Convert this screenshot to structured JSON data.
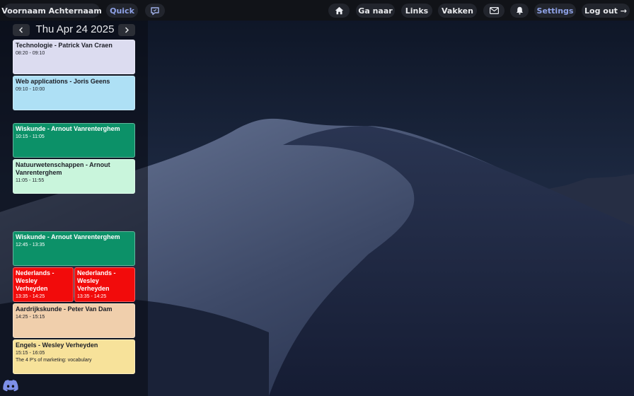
{
  "topbar": {
    "user_name": "Voornaam Achternaam",
    "quick_label": "Quick",
    "ga_naar_label": "Ga naar",
    "links_label": "Links",
    "vakken_label": "Vakken",
    "settings_label": "Settings",
    "logout_label": "Log out →",
    "icons": [
      "home-icon",
      "chat-icon",
      "mail-icon",
      "bell-icon"
    ]
  },
  "calendar": {
    "date": "Thu Apr 24 2025",
    "events": [
      {
        "title": "Technologie - Patrick Van Craen",
        "time": "08:20 - 09:10",
        "note": "",
        "color": "#dcdcf0"
      },
      {
        "title": "Web applications - Joris Geens",
        "time": "09:10 - 10:00",
        "note": "",
        "color": "#aee0f5"
      },
      {
        "title": "Wiskunde - Arnout Vanrenterghem",
        "time": "10:15 - 11:05",
        "note": "",
        "color": "#0c9168"
      },
      {
        "title": "Natuurwetenschappen - Arnout Vanrenterghem",
        "time": "11:05 - 11:55",
        "note": "",
        "color": "#c9f5dc"
      },
      {
        "title": "Wiskunde - Arnout Vanrenterghem",
        "time": "12:45 - 13:35",
        "note": "",
        "color": "#0c9168"
      },
      {
        "title": "Nederlands - Wesley Verheyden",
        "time": "13:35 - 14:25",
        "note": "",
        "color": "#f20b0b"
      },
      {
        "title": "Nederlands - Wesley Verheyden",
        "time": "13:35 - 14:25",
        "note": "",
        "color": "#f20b0b"
      },
      {
        "title": "Aardrijkskunde - Peter Van Dam",
        "time": "14:25 - 15:15",
        "note": "",
        "color": "#f0cfac"
      },
      {
        "title": "Engels - Wesley Verheyden",
        "time": "15:15 - 16:05",
        "note": "The 4 P's of marketing: vocabulary",
        "color": "#f7e29a"
      }
    ]
  }
}
